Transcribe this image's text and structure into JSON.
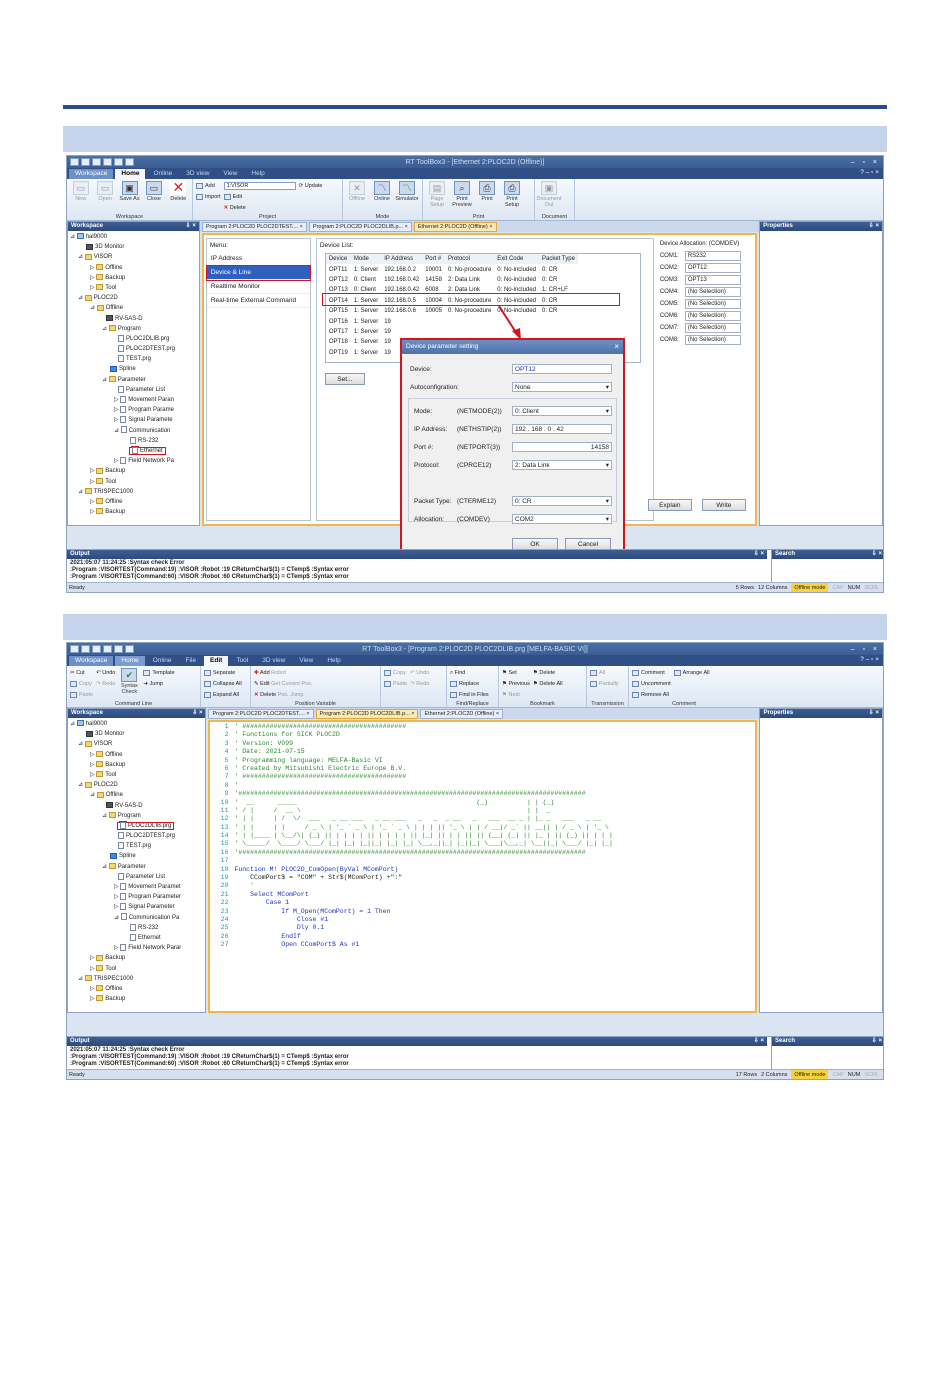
{
  "s1": {
    "title": "RT ToolBox3 - [Ethernet 2:PLOC2D  (Offline)]",
    "tabs": [
      "Workspace",
      "Home",
      "Online",
      "3D view",
      "View",
      "Help"
    ],
    "ribbon": {
      "new": "New",
      "open": "Open",
      "save": "Save As",
      "close": "Close",
      "delete": "Delete",
      "g_workspace": "Workspace",
      "add": "Add",
      "import": "Import",
      "robot_combo": "1:VISOR",
      "edit": "Edit",
      "del": "Delete",
      "update": "Update",
      "g_project": "Project",
      "offline": "Offline",
      "online": "Online",
      "simulator": "Simulator",
      "g_mode": "Mode",
      "page_setup": "Page Setup",
      "print_preview": "Print Preview",
      "print": "Print",
      "print_setup": "Print Setup",
      "g_print": "Print",
      "doc_out": "Document Out",
      "g_document": "Document"
    },
    "workspace_title": "Workspace",
    "tree": [
      "hal9000",
      "3D Monitor",
      "VISOR",
      "Offline",
      "Backup",
      "Tool",
      "PLOC2D",
      "Offline",
      "RV-5AS-D",
      "Program",
      "PLOC2DLIB.prg",
      "PLOC2DTEST.prg",
      "TEST.prg",
      "Spline",
      "Parameter",
      "Parameter List",
      "Movement Paran",
      "Program Parame",
      "Signal Paramete",
      "Communication",
      "RS-232",
      "Ethernet",
      "Field Network Pa",
      "Backup",
      "Tool",
      "TRISPEC1000",
      "Offline",
      "Backup"
    ],
    "doc_tabs": [
      "Program 2:PLOC2D PLOC2DTEST....",
      "Program 2:PLOC2D PLOC2DLIB.p...",
      "Ethernet 2:PLOC2D  (Offline)"
    ],
    "menu_title": "Menu:",
    "menu": [
      "IP Address",
      "Device & Line",
      "Realtime Monitor",
      "Real-time External Command"
    ],
    "device_list_title": "Device List:",
    "device_cols": [
      "Device",
      "Mode",
      "IP Address",
      "Port #",
      "Protocol",
      "Exit Code",
      "Packet Type"
    ],
    "devices": [
      [
        "OPT11",
        "1: Server",
        "192.168.0.2",
        "10001",
        "0: No-procedure",
        "0: No-included",
        "0: CR"
      ],
      [
        "OPT12",
        "0: Client",
        "192.168.0.42",
        "14158",
        "2: Data Link",
        "0: No-included",
        "0: CR"
      ],
      [
        "OPT13",
        "0: Client",
        "192.168.0.42",
        "6008",
        "2: Data Link",
        "0: No-included",
        "1: CR+LF"
      ],
      [
        "OPT14",
        "1: Server",
        "192.168.0.5",
        "10004",
        "0: No-procedure",
        "0: No-included",
        "0: CR"
      ],
      [
        "OPT15",
        "1: Server",
        "192.168.0.6",
        "10005",
        "0: No-procedure",
        "0: No-included",
        "0: CR"
      ],
      [
        "OPT16",
        "1: Server",
        "19",
        "",
        "",
        "",
        ""
      ],
      [
        "OPT17",
        "1: Server",
        "19",
        "",
        "",
        "",
        ""
      ],
      [
        "OPT18",
        "1: Server",
        "19",
        "",
        "",
        "",
        ""
      ],
      [
        "OPT19",
        "1: Server",
        "19",
        "",
        "",
        "",
        ""
      ]
    ],
    "set_btn": "Set...",
    "alloc_title": "Device Allocation: (COMDEV)",
    "alloc": [
      [
        "COM1:",
        "RS232"
      ],
      [
        "COM2:",
        "OPT12"
      ],
      [
        "COM3:",
        "OPT13"
      ],
      [
        "COM4:",
        "(No Selection)"
      ],
      [
        "COM5:",
        "(No Selection)"
      ],
      [
        "COM6:",
        "(No Selection)"
      ],
      [
        "COM7:",
        "(No Selection)"
      ],
      [
        "COM8:",
        "(No Selection)"
      ]
    ],
    "explain": "Explain",
    "write": "Write",
    "properties": "Properties",
    "dialog": {
      "title": "Device parameter setting",
      "device_lbl": "Device:",
      "device": "OPT12",
      "autoconf_lbl": "Autoconfigration:",
      "autoconf": "None",
      "mode_lbl": "Mode:",
      "mode_param": "(NETMODE(2))",
      "mode": "0: Client",
      "ip_lbl": "IP Address:",
      "ip_param": "(NETHSTIP(2))",
      "ip": "192 . 168 . 0 . 42",
      "port_lbl": "Port #:",
      "port_param": "(NETPORT(3))",
      "port": "14158",
      "proto_lbl": "Protocol:",
      "proto_param": "(CPRCE12)",
      "proto": "2: Data Link",
      "packet_lbl": "Packet Type:",
      "packet_param": "(CTERME12)",
      "packet": "0: CR",
      "alloc_lbl": "Allocation:",
      "alloc_param": "(COMDEV)",
      "alloc": "COM2",
      "ok": "OK",
      "cancel": "Cancel"
    },
    "output_title": "Output",
    "output": [
      "2021:05:07 11:24:25   :Syntax check Error",
      ":Program   :VISORTEST(Command:19) :VISOR  :Robot :19        CReturnChar$(1) = CTemp$     :Syntax error",
      ":Program   :VISORTEST(Command:60) :VISOR  :Robot :60      CReturnChar$(1) = CTemp$   :Syntax error"
    ],
    "search": "Search",
    "status": {
      "ready": "Ready",
      "rows": "5 Rows",
      "cols": "12 Columns",
      "mode": "Offline mode",
      "cap": "CAP",
      "num": "NUM",
      "scrl": "SCRL"
    }
  },
  "s2": {
    "title": "RT ToolBox3 - [Program 2:PLOC2D PLOC2DLIB.prg  [MELFA-BASIC VI]]",
    "tabs": [
      "Workspace",
      "Home",
      "Online",
      "File",
      "Edit",
      "Tool",
      "3D view",
      "View",
      "Help"
    ],
    "ribbon": {
      "cut": "Cut",
      "copy": "Copy",
      "paste": "Paste",
      "undo": "Undo",
      "redo": "Redo",
      "syntax": "Syntax Check",
      "template": "Template",
      "jump": "Jump",
      "g_cmd": "Command Line",
      "separate": "Separate",
      "collapse": "Collapse All",
      "expand": "Expand All",
      "add": "Add",
      "robot": "Robot",
      "edit": "Edit",
      "get_pos": "Get Current Pos.",
      "del": "Delete",
      "pos_jump": "Pos. Jump",
      "g_pos": "Position Variable",
      "copy2": "Copy",
      "paste2": "Paste",
      "undo2": "Undo",
      "redo2": "Redo",
      "find": "Find",
      "replace": "Replace",
      "find_files": "Find in Files",
      "g_find": "Find/Replace",
      "set": "Set",
      "previous": "Previous",
      "next": "Next",
      "delete": "Delete",
      "delete_all": "Delete All",
      "g_bookmark": "Bookmark",
      "all": "All",
      "partially": "Partially",
      "g_trans": "Transmission",
      "comment": "Comment",
      "uncomment": "Uncomment",
      "remove_all": "Remove All",
      "arrange_all": "Arrange All",
      "g_comment": "Comment"
    },
    "workspace_title": "Workspace",
    "tree": [
      "hal9000",
      "3D Monitor",
      "VISOR",
      "Offline",
      "Backup",
      "Tool",
      "PLOC2D",
      "Offline",
      "RV-5AS-D",
      "Program",
      "PLOC2DLIB.prg",
      "PLOC2DTEST.prg",
      "TEST.prg",
      "Spline",
      "Parameter",
      "Parameter List",
      "Movement Paramet",
      "Program Parameter",
      "Signal Parameter",
      "Communication Pa",
      "RS-232",
      "Ethernet",
      "Field Network Parar",
      "Backup",
      "Tool",
      "TRISPEC1000",
      "Offline",
      "Backup"
    ],
    "doc_tabs": [
      "Program 2:PLOC2D PLOC2DTEST....",
      "Program 2:PLOC2D PLOC2DLIB.p...",
      "Ethernet 2:PLOC2D  (Offline)"
    ],
    "code": [
      "' ##########################################",
      "' Functions for SICK PLOC2D",
      "' Version: V099",
      "' Date: 2021-07-15",
      "' Programming language: MELFA-Basic VI",
      "' Created by Mitsubishi Electric Europe B.V.",
      "' ##########################################",
      "'",
      "'#########################################################################################",
      "'  __      _____                                              (_)          | | (_)",
      "' / |     /  __ \\                                                          | |  _",
      "' | |     | /  \\/  ___   _ __ ___   _ __ ___   _   _  _ __   _   ___  __ _ | |_ _   ___   _ __",
      "' | |     | |     / _ \\ | '_ ` _ \\ | '_ ` _ \\ | | | || '_ \\ | | / __|/ _` || __|| | / _ \\ | '_ \\",
      "' | |____ | \\__/\\| (_) || | | | | || | | | | || |_| || | | || || (__| (_| || |_ | || (_) || | | |",
      "' \\_____/  \\____/ \\___/ |_| |_| |_||_| |_| |_| \\__,_||_| |_||_| \\___|\\__,_| \\__||_| \\___/ |_| |_|",
      "'#########################################################################################",
      "",
      "Function M! PLOC2D_ComOpen(ByVal MComPort)",
      "    CComPort$ = \"COM\" + Str$(MComPort) +\":\"",
      "    '",
      "    Select MComPort",
      "        Case 1",
      "            If M_Open(MComPort) = 1 Then",
      "                Close #1",
      "                Dly 0.1",
      "            EndIf",
      "            Open CComPort$ As #1"
    ],
    "properties": "Properties",
    "output_title": "Output",
    "output": [
      "2021:05:07 11:24:25   :Syntax check Error",
      ":Program   :VISORTEST(Command:19) :VISOR  :Robot :19        CReturnChar$(1) = CTemp$     :Syntax error",
      ":Program   :VISORTEST(Command:60) :VISOR  :Robot :60      CReturnChar$(1) = CTemp$   :Syntax error"
    ],
    "search": "Search",
    "status": {
      "ready": "Ready",
      "rows": "17 Rows",
      "cols": "2 Columns",
      "mode": "Offline mode",
      "cap": "CAP",
      "num": "NUM",
      "scrl": "SCRL"
    }
  },
  "colors": {
    "accent": "#2c4a8c",
    "highlight": "#d0181c",
    "offline": "#f7d23a"
  }
}
